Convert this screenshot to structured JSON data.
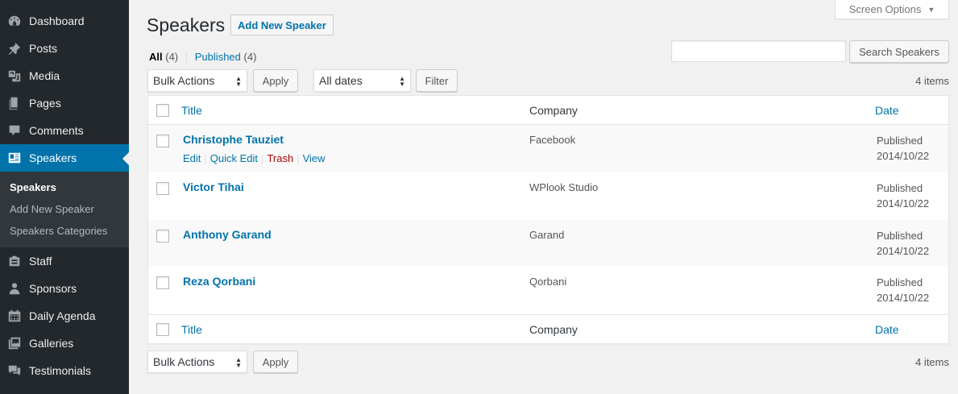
{
  "sidebar": {
    "items_top": [
      {
        "label": "Dashboard",
        "icon": "dashboard-icon"
      },
      {
        "label": "Posts",
        "icon": "pin-icon"
      },
      {
        "label": "Media",
        "icon": "media-icon"
      },
      {
        "label": "Pages",
        "icon": "pages-icon"
      },
      {
        "label": "Comments",
        "icon": "comments-icon"
      }
    ],
    "current": {
      "label": "Speakers",
      "icon": "id-card-icon"
    },
    "submenu": [
      {
        "label": "Speakers"
      },
      {
        "label": "Add New Speaker"
      },
      {
        "label": "Speakers Categories"
      }
    ],
    "items_bottom": [
      {
        "label": "Staff",
        "icon": "staff-icon"
      },
      {
        "label": "Sponsors",
        "icon": "sponsors-icon"
      },
      {
        "label": "Daily Agenda",
        "icon": "calendar-icon"
      },
      {
        "label": "Galleries",
        "icon": "galleries-icon"
      },
      {
        "label": "Testimonials",
        "icon": "testimonials-icon"
      }
    ]
  },
  "header": {
    "screen_options": "Screen Options",
    "title": "Speakers",
    "add_new": "Add New Speaker"
  },
  "filters": {
    "all_label": "All",
    "all_count": "(4)",
    "sep": "|",
    "published_label": "Published",
    "published_count": "(4)",
    "search_button": "Search Speakers",
    "search_value": ""
  },
  "tablenav_top": {
    "bulk_actions": "Bulk Actions",
    "apply": "Apply",
    "dates": "All dates",
    "filter": "Filter",
    "items": "4 items"
  },
  "tablenav_bottom": {
    "bulk_actions": "Bulk Actions",
    "apply": "Apply",
    "items": "4 items"
  },
  "table": {
    "columns": {
      "title": "Title",
      "company": "Company",
      "date": "Date"
    },
    "row_actions": {
      "edit": "Edit",
      "quick_edit": "Quick Edit",
      "trash": "Trash",
      "view": "View",
      "sep": "|"
    },
    "rows": [
      {
        "title": "Christophe Tauziet",
        "company": "Facebook",
        "status": "Published",
        "date": "2014/10/22"
      },
      {
        "title": "Victor Tihai",
        "company": "WPlook Studio",
        "status": "Published",
        "date": "2014/10/22"
      },
      {
        "title": "Anthony Garand",
        "company": "Garand",
        "status": "Published",
        "date": "2014/10/22"
      },
      {
        "title": "Reza Qorbani",
        "company": "Qorbani",
        "status": "Published",
        "date": "2014/10/22"
      }
    ]
  }
}
